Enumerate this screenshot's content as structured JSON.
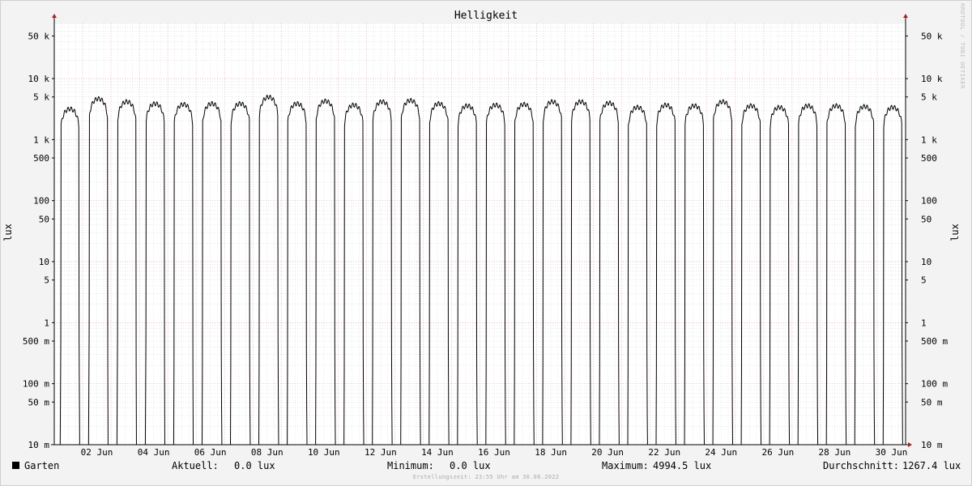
{
  "chart_data": {
    "type": "line",
    "title": "Helligkeit",
    "ylabel": "lux",
    "ylabel_right": "lux",
    "y_scale": "log",
    "ylim": [
      0.01,
      80000
    ],
    "xlim": [
      "2022-06-01",
      "2022-07-01"
    ],
    "x_ticks": [
      "02 Jun",
      "04 Jun",
      "06 Jun",
      "08 Jun",
      "10 Jun",
      "12 Jun",
      "14 Jun",
      "16 Jun",
      "18 Jun",
      "20 Jun",
      "22 Jun",
      "24 Jun",
      "26 Jun",
      "28 Jun",
      "30 Jun"
    ],
    "y_ticks": [
      {
        "value": 50000,
        "label": "50 k"
      },
      {
        "value": 10000,
        "label": "10 k"
      },
      {
        "value": 5000,
        "label": "5 k"
      },
      {
        "value": 1000,
        "label": "1 k"
      },
      {
        "value": 500,
        "label": "500"
      },
      {
        "value": 100,
        "label": "100"
      },
      {
        "value": 50,
        "label": "50"
      },
      {
        "value": 10,
        "label": "10"
      },
      {
        "value": 5,
        "label": "5"
      },
      {
        "value": 1,
        "label": "1"
      },
      {
        "value": 0.5,
        "label": "500 m"
      },
      {
        "value": 0.1,
        "label": "100 m"
      },
      {
        "value": 0.05,
        "label": "50 m"
      },
      {
        "value": 0.01,
        "label": "10 m"
      }
    ],
    "grid": true,
    "series": [
      {
        "name": "Garten",
        "color": "#000000",
        "daily_peak_lux": [
          3200,
          4700,
          4200,
          3900,
          3800,
          3900,
          3900,
          5000,
          3900,
          4300,
          3700,
          4200,
          4400,
          3900,
          3600,
          3700,
          3800,
          4200,
          4200,
          4000,
          3400,
          3700,
          3600,
          4200,
          3600,
          3400,
          3600,
          3600,
          3500,
          3400
        ],
        "daily_sunrise_hour": [
          4.9,
          4.9,
          4.9,
          4.9,
          4.8,
          4.8,
          4.8,
          4.8,
          4.8,
          4.8,
          4.8,
          4.8,
          4.8,
          4.8,
          4.8,
          4.8,
          4.8,
          4.8,
          4.8,
          4.8,
          4.8,
          4.8,
          4.8,
          4.8,
          4.8,
          4.8,
          4.8,
          4.8,
          4.8,
          4.8
        ],
        "daily_sunset_hour": [
          21.6,
          21.7,
          21.7,
          21.7,
          21.7,
          21.8,
          21.8,
          21.8,
          21.8,
          21.8,
          21.8,
          21.8,
          21.8,
          21.8,
          21.8,
          21.8,
          21.8,
          21.8,
          21.8,
          21.8,
          21.8,
          21.8,
          21.8,
          21.8,
          21.8,
          21.8,
          21.8,
          21.8,
          21.8,
          21.6
        ]
      }
    ]
  },
  "legend": {
    "series_name": "Garten",
    "current_label": "Aktuell:",
    "current_value": "0.0 lux",
    "minimum_label": "Minimum:",
    "minimum_value": "0.0 lux",
    "maximum_label": "Maximum:",
    "maximum_value": "4994.5 lux",
    "average_label": "Durchschnitt:",
    "average_value": "1267.4 lux"
  },
  "footer": "Erstellungszeit: 23:55 Uhr am 30.06.2022",
  "watermark": "RRDTOOL / TOBI OETIKER",
  "colors": {
    "background": "#f3f3f3",
    "plot": "#ffffff",
    "minor_grid": "#d8d8d8",
    "major_grid": "#e8a0a0",
    "axis": "#000000",
    "arrow": "#b02020"
  }
}
